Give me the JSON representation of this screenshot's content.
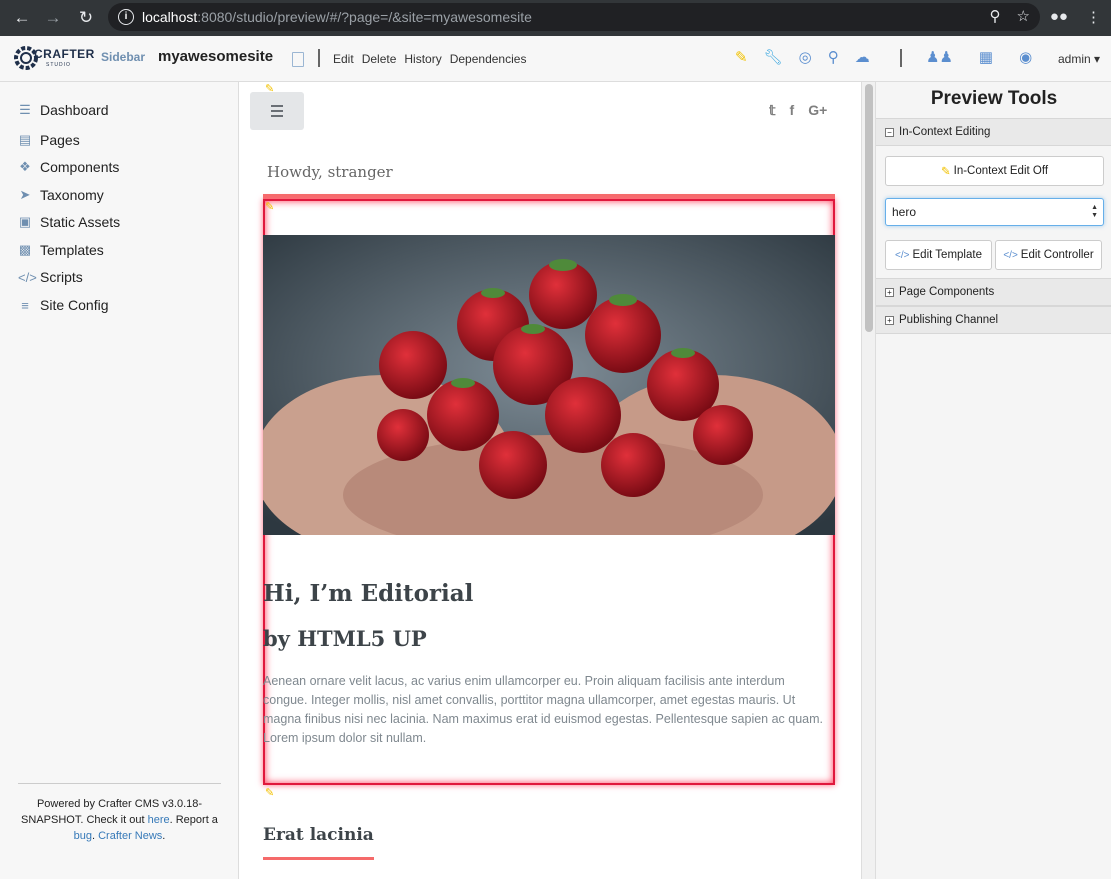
{
  "browser": {
    "url_host": "localhost",
    "url_rest": ":8080/studio/preview/#/?page=/&site=myawesomesite"
  },
  "toolbar": {
    "logo_text": "CRAFTER",
    "logo_sub": "STUDIO",
    "sidebar_label": "Sidebar",
    "site_name": "myawesomesite",
    "actions": [
      "Edit",
      "Delete",
      "History",
      "Dependencies"
    ],
    "user": "admin",
    "colors": {
      "pencil": "#f2c200",
      "wrench": "#3fa9e0",
      "icons": "#5b8ecf"
    }
  },
  "sidebar": {
    "items": [
      {
        "label": "Dashboard",
        "icon": "dashboard-icon"
      },
      {
        "label": "Pages",
        "icon": "page-icon"
      },
      {
        "label": "Components",
        "icon": "puzzle-icon"
      },
      {
        "label": "Taxonomy",
        "icon": "tags-icon"
      },
      {
        "label": "Static Assets",
        "icon": "image-icon"
      },
      {
        "label": "Templates",
        "icon": "code-file-icon"
      },
      {
        "label": "Scripts",
        "icon": "code-icon"
      },
      {
        "label": "Site Config",
        "icon": "sliders-icon"
      }
    ],
    "footer": {
      "text1": "Powered by Crafter CMS v3.0.18-SNAPSHOT. Check it out ",
      "link_here": "here",
      "text2": ". Report a ",
      "link_bug": "bug",
      "text3": ". ",
      "link_news": "Crafter News",
      "text4": "."
    }
  },
  "preview": {
    "greeting": "Howdy, stranger",
    "hero_title": "Hi, I’m Editorial",
    "hero_subtitle": "by HTML5 UP",
    "hero_body": "Aenean ornare velit lacus, ac varius enim ullamcorper eu. Proin aliquam facilisis ante interdum congue. Integer mollis, nisl amet convallis, porttitor magna ullamcorper, amet egestas mauris. Ut magna finibus nisi nec lacinia. Nam maximus erat id euismod egestas. Pellentesque sapien ac quam. Lorem ipsum dolor sit nullam.",
    "next_heading": "Erat lacinia",
    "accent_color": "#f56a6a"
  },
  "tools": {
    "title": "Preview Tools",
    "section_editing": "In-Context Editing",
    "edit_toggle": "In-Context Edit Off",
    "selected_component": "hero",
    "edit_template": "Edit Template",
    "edit_controller": "Edit Controller",
    "section_components": "Page Components",
    "section_publishing": "Publishing Channel"
  }
}
